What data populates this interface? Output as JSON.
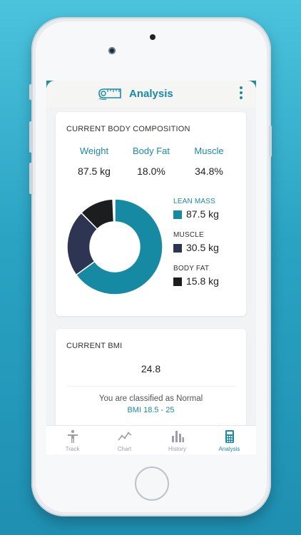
{
  "header": {
    "title": "Analysis"
  },
  "composition": {
    "heading": "CURRENT BODY COMPOSITION",
    "stats": [
      {
        "label": "Weight",
        "value": "87.5 kg"
      },
      {
        "label": "Body Fat",
        "value": "18.0%"
      },
      {
        "label": "Muscle",
        "value": "34.8%"
      }
    ],
    "legend": [
      {
        "label": "LEAN MASS",
        "value": "87.5 kg",
        "color": "#178aa3",
        "label_color": "#1b8aa6"
      },
      {
        "label": "MUSCLE",
        "value": "30.5 kg",
        "color": "#2e3552",
        "label_color": "#333333"
      },
      {
        "label": "BODY FAT",
        "value": "15.8 kg",
        "color": "#1c1d1f",
        "label_color": "#333333"
      }
    ],
    "donut_fractions": [
      0.65,
      0.226,
      0.117
    ]
  },
  "bmi": {
    "heading": "CURRENT BMI",
    "value": "24.8",
    "classification": "You are classified as Normal",
    "range": "BMI 18.5 - 25"
  },
  "tabs": [
    {
      "label": "Track",
      "icon": "person-icon",
      "active": false
    },
    {
      "label": "Chart",
      "icon": "line-chart-icon",
      "active": false
    },
    {
      "label": "History",
      "icon": "bar-chart-icon",
      "active": false
    },
    {
      "label": "Analysis",
      "icon": "calculator-icon",
      "active": true
    }
  ],
  "colors": {
    "accent": "#1b8aa6",
    "background_gradient_top": "#4cc3dd",
    "background_gradient_bottom": "#1f8fb1"
  }
}
